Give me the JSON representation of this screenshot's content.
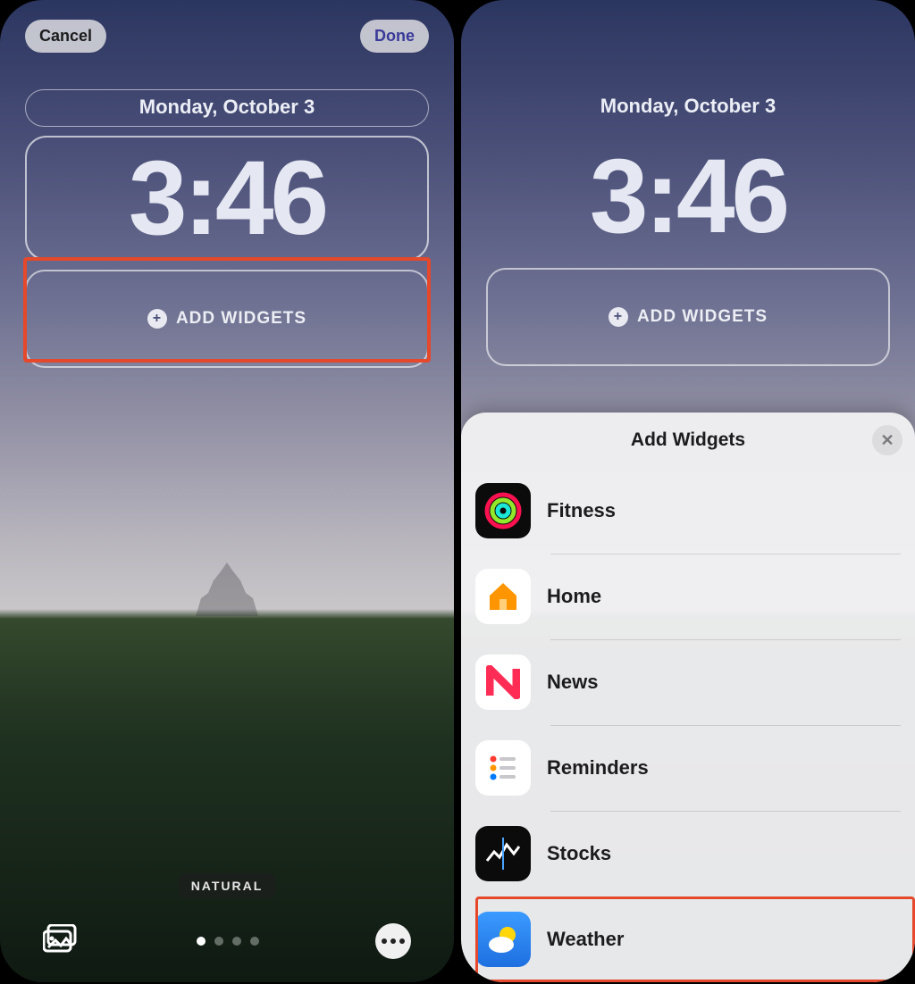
{
  "header": {
    "cancel": "Cancel",
    "done": "Done"
  },
  "lock": {
    "date": "Monday, October 3",
    "time": "3:46",
    "add_widgets_label": "ADD WIDGETS"
  },
  "filter_chip": "NATURAL",
  "sheet": {
    "title": "Add Widgets",
    "items": [
      {
        "label": "Fitness",
        "icon": "fitness-rings-icon",
        "bg": "#0b0b0b"
      },
      {
        "label": "Home",
        "icon": "house-icon",
        "bg": "#ffffff"
      },
      {
        "label": "News",
        "icon": "news-n-icon",
        "bg": "#ffffff"
      },
      {
        "label": "Reminders",
        "icon": "reminders-list-icon",
        "bg": "#ffffff"
      },
      {
        "label": "Stocks",
        "icon": "stocks-chart-icon",
        "bg": "#0b0b0b"
      },
      {
        "label": "Weather",
        "icon": "weather-sun-cloud-icon",
        "bg": "#2f8dff"
      }
    ]
  },
  "highlight": {
    "left": "add-widgets",
    "right": "Weather"
  }
}
